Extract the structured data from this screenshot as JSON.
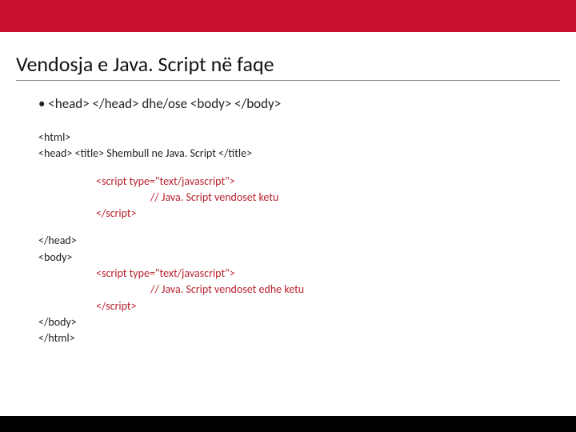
{
  "title": "Vendosja e Java. Script në faqe",
  "bullet": "• <head> </head> dhe/ose <body> </body>",
  "code": {
    "l1": "<html>",
    "l2a": "<head>",
    "l2b": " <title> Shembull ne Java. Script </title>",
    "l3": "<script type=\"text/javascript\">",
    "l4": "// Java. Script vendoset ketu",
    "l5": "</script>",
    "l6": "</head>",
    "l7": "<body>",
    "l8": "<script type=\"text/javascript\">",
    "l9": "// Java. Script vendoset edhe ketu",
    "l10": "</script>",
    "l11": "</body>",
    "l12": "</html>"
  }
}
